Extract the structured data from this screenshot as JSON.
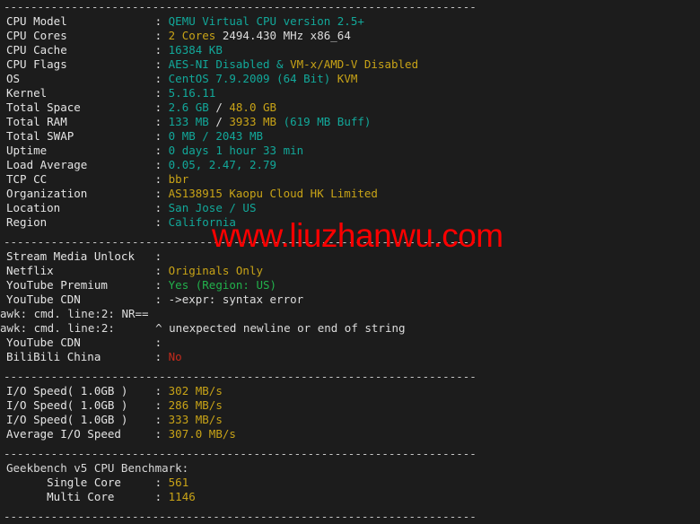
{
  "terminal": {
    "separator": "----------------------------------------------------------------------",
    "label_width": 22,
    "watermark": "www.liuzhanwu.com",
    "colors": {
      "background": "#1c1c1c",
      "label": "#e4e4e4",
      "teal": "#12a89a",
      "yellow": "#c8a317",
      "white": "#dcdcdc",
      "green": "#22b14c",
      "red": "#c42b1c",
      "watermark": "#fb0000"
    }
  },
  "system_info": {
    "rows": [
      {
        "label": "CPU Model",
        "value": "QEMU Virtual CPU version 2.5+",
        "parts": [
          {
            "t": "QEMU Virtual CPU version 2.5+",
            "c": "teal"
          }
        ]
      },
      {
        "label": "CPU Cores",
        "value": "2 Cores 2494.430 MHz x86_64",
        "parts": [
          {
            "t": "2 Cores",
            "c": "yellow"
          },
          {
            "t": " 2494.430 MHz x86_64",
            "c": "white"
          }
        ]
      },
      {
        "label": "CPU Cache",
        "value": "16384 KB",
        "parts": [
          {
            "t": "16384 KB",
            "c": "teal"
          }
        ]
      },
      {
        "label": "CPU Flags",
        "value": "AES-NI Disabled & VM-x/AMD-V Disabled",
        "parts": [
          {
            "t": "AES-NI Disabled & ",
            "c": "teal"
          },
          {
            "t": "VM-x/AMD-V Disabled",
            "c": "yellow"
          }
        ]
      },
      {
        "label": "OS",
        "value": "CentOS 7.9.2009 (64 Bit) KVM",
        "parts": [
          {
            "t": "CentOS 7.9.2009 (64 Bit) ",
            "c": "teal"
          },
          {
            "t": "KVM",
            "c": "yellow"
          }
        ]
      },
      {
        "label": "Kernel",
        "value": "5.16.11",
        "parts": [
          {
            "t": "5.16.11",
            "c": "teal"
          }
        ]
      },
      {
        "label": "Total Space",
        "value": "2.6 GB / 48.0 GB",
        "parts": [
          {
            "t": "2.6 GB",
            "c": "teal"
          },
          {
            "t": " / ",
            "c": "white"
          },
          {
            "t": "48.0 GB",
            "c": "yellow"
          }
        ]
      },
      {
        "label": "Total RAM",
        "value": "133 MB / 3933 MB (619 MB Buff)",
        "parts": [
          {
            "t": "133 MB",
            "c": "teal"
          },
          {
            "t": " / ",
            "c": "white"
          },
          {
            "t": "3933 MB",
            "c": "yellow"
          },
          {
            "t": " (619 MB Buff)",
            "c": "teal"
          }
        ]
      },
      {
        "label": "Total SWAP",
        "value": "0 MB / 2043 MB",
        "parts": [
          {
            "t": "0 MB / 2043 MB",
            "c": "teal"
          }
        ]
      },
      {
        "label": "Uptime",
        "value": "0 days 1 hour 33 min",
        "parts": [
          {
            "t": "0 days 1 hour 33 min",
            "c": "teal"
          }
        ]
      },
      {
        "label": "Load Average",
        "value": "0.05, 2.47, 2.79",
        "parts": [
          {
            "t": "0.05, 2.47, 2.79",
            "c": "teal"
          }
        ]
      },
      {
        "label": "TCP CC",
        "value": "bbr",
        "parts": [
          {
            "t": "bbr",
            "c": "yellow"
          }
        ]
      },
      {
        "label": "Organization",
        "value": "AS138915 Kaopu Cloud HK Limited",
        "parts": [
          {
            "t": "AS138915 Kaopu Cloud HK Limited",
            "c": "yellow"
          }
        ]
      },
      {
        "label": "Location",
        "value": "San Jose / US",
        "parts": [
          {
            "t": "San Jose / US",
            "c": "teal"
          }
        ]
      },
      {
        "label": "Region",
        "value": "California",
        "parts": [
          {
            "t": "California",
            "c": "teal"
          }
        ]
      }
    ]
  },
  "stream_media": {
    "rows": [
      {
        "label": "Stream Media Unlock",
        "value": "",
        "parts": []
      },
      {
        "label": "Netflix",
        "value": "Originals Only",
        "parts": [
          {
            "t": "Originals Only",
            "c": "yellow"
          }
        ]
      },
      {
        "label": "YouTube Premium",
        "value": "Yes (Region: US)",
        "parts": [
          {
            "t": "Yes (Region: US)",
            "c": "green"
          }
        ]
      },
      {
        "label": "YouTube CDN",
        "value": "->expr: syntax error",
        "parts": [
          {
            "t": "->expr: syntax error",
            "c": "white"
          }
        ]
      }
    ],
    "errors": [
      "awk: cmd. line:2: NR==",
      "awk: cmd. line:2:      ^ unexpected newline or end of string"
    ],
    "rows_after": [
      {
        "label": "YouTube CDN",
        "value": "",
        "parts": []
      },
      {
        "label": "BiliBili China",
        "value": "No",
        "parts": [
          {
            "t": "No",
            "c": "red"
          }
        ]
      }
    ]
  },
  "io_speed": {
    "rows": [
      {
        "label": "I/O Speed( 1.0GB )",
        "value": "302 MB/s",
        "parts": [
          {
            "t": "302 MB/s",
            "c": "yellow"
          }
        ]
      },
      {
        "label": "I/O Speed( 1.0GB )",
        "value": "286 MB/s",
        "parts": [
          {
            "t": "286 MB/s",
            "c": "yellow"
          }
        ]
      },
      {
        "label": "I/O Speed( 1.0GB )",
        "value": "333 MB/s",
        "parts": [
          {
            "t": "333 MB/s",
            "c": "yellow"
          }
        ]
      },
      {
        "label": "Average I/O Speed",
        "value": "307.0 MB/s",
        "parts": [
          {
            "t": "307.0 MB/s",
            "c": "yellow"
          }
        ]
      }
    ]
  },
  "geekbench": {
    "title": "Geekbench v5 CPU Benchmark:",
    "rows": [
      {
        "label": "      Single Core",
        "value": "561",
        "parts": [
          {
            "t": "561",
            "c": "yellow"
          }
        ]
      },
      {
        "label": "      Multi Core",
        "value": "1146",
        "parts": [
          {
            "t": "1146",
            "c": "yellow"
          }
        ]
      }
    ]
  }
}
